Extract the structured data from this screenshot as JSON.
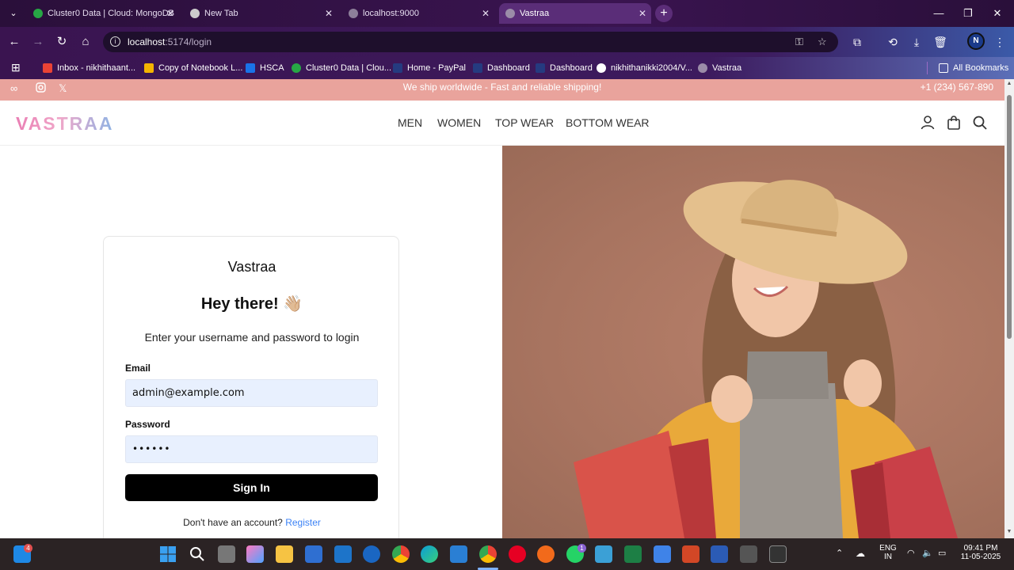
{
  "browser": {
    "tabs": [
      {
        "title": "Cluster0 Data | Cloud: MongoDB",
        "active": false
      },
      {
        "title": "New Tab",
        "active": false
      },
      {
        "title": "localhost:9000",
        "active": false
      },
      {
        "title": "Vastraa",
        "active": true
      }
    ],
    "url_host": "localhost",
    "url_path": ":5174/login",
    "bookmarks": [
      "Inbox - nikhithaant...",
      "Copy of Notebook L...",
      "HSCA",
      "Cluster0 Data | Clou...",
      "Home - PayPal",
      "Dashboard",
      "Dashboard",
      "nikhithanikki2004/V...",
      "Vastraa"
    ],
    "all_bookmarks": "All Bookmarks",
    "profile_initial": "N"
  },
  "topbar": {
    "message": "We ship worldwide - Fast and reliable shipping!",
    "phone": "+1 (234) 567-890"
  },
  "header": {
    "logo": "VASTRAA",
    "nav": [
      "MEN",
      "WOMEN",
      "TOP WEAR",
      "BOTTOM WEAR"
    ]
  },
  "login": {
    "brand": "Vastraa",
    "greeting": "Hey there! 👋🏼",
    "subtitle": "Enter your username and password to login",
    "email_label": "Email",
    "email_value": "admin@example.com",
    "password_label": "Password",
    "password_value": "••••••",
    "signin_label": "Sign In",
    "register_prompt": "Don't have an account?",
    "register_link": "Register"
  },
  "taskbar": {
    "store_badge": "4",
    "whatsapp_badge": "1",
    "lang": "ENG",
    "region": "IN",
    "time": "09:41 PM",
    "date": "11-05-2025"
  },
  "colors": {
    "topbar": "#e9a39c",
    "hero_bg": "#a87460",
    "input_bg": "#e8f0fe",
    "button": "#000000",
    "link": "#3b82f6"
  }
}
